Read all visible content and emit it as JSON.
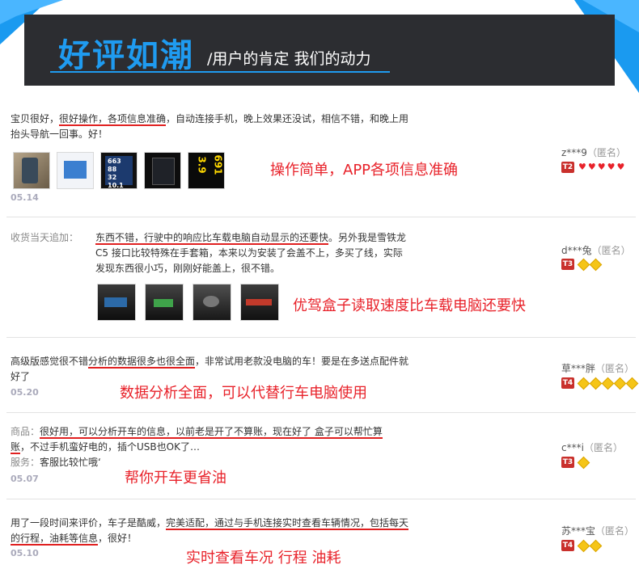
{
  "header": {
    "title": "好评如潮",
    "subtitle": "/用户的肯定 我们的动力"
  },
  "reviews": [
    {
      "line1_a": "宝贝很好，",
      "line1_u": "很好操作，各项信息准确",
      "line1_b": "，自动连接手机，晚上效果还没试，相信不错，和晚上用",
      "line2": "抬头导航一回事。好！",
      "date": "05.14",
      "annotation": "操作简单，APP各项信息准确",
      "user": "z***9",
      "anon": "（匿名）",
      "level": "T2",
      "hearts": 5
    },
    {
      "prefix": "收货当天追加：",
      "line1_u": "东西不错，行驶中的响应比车载电脑自动显示的还要快",
      "line1_b": "。另外我是雪铁龙",
      "line2": "C5 接口比较特殊在手套箱，本来以为安装了会盖不上，多买了线，实际",
      "line3": "发现东西很小巧，刚刚好能盖上，很不错。",
      "annotation": "优驾盒子读取速度比车载电脑还要快",
      "user": "d***兔",
      "anon": "（匿名）",
      "level": "T3",
      "diamonds": 2
    },
    {
      "line1_a": "高级版感觉很不错",
      "line1_u": "分析的数据很多也很全面",
      "line1_b": "，非常试用老款没电脑的车！要是在多送点配件就",
      "line2": "好了",
      "date": "05.20",
      "annotation": "数据分析全面，可以代替行车电脑使用",
      "user": "草***胖",
      "anon": "（匿名）",
      "level": "T4",
      "diamonds": 5
    },
    {
      "line1_label": "商品：",
      "line1_u": "很好用，可以分析开车的信息，以前老是开了不算账，现在好了 盒子可以帮忙算",
      "line2_u": "账",
      "line2_b": "，不过手机蛮好电的，插个USB也OK了…",
      "line3_label": "服务：",
      "line3": "客服比较忙哦‘",
      "date": "05.07",
      "annotation": "帮你开车更省油",
      "user": "c***i",
      "anon": "（匿名）",
      "level": "T3",
      "diamonds": 1
    },
    {
      "line1_a": "用了一段时间来评价，车子是酷威，",
      "line1_u": "完美适配，通过与手机连接实时查看车辆情况，包括每天",
      "line2_u": "的行程，油耗等信息",
      "line2_b": "，很好！",
      "date": "05.10",
      "annotation": "实时查看车况 行程 油耗",
      "user": "苏***宝",
      "anon": "（匿名）",
      "level": "T4",
      "diamonds": 2
    }
  ],
  "thumbs": {
    "r1": [
      "photo-car-dash",
      "photo-screen-blue",
      "device-663-88",
      "device-app-screen",
      "device-39-691"
    ],
    "r2": [
      "photo-car-night-1",
      "photo-car-night-2",
      "photo-car-night-3",
      "photo-car-night-4"
    ]
  }
}
